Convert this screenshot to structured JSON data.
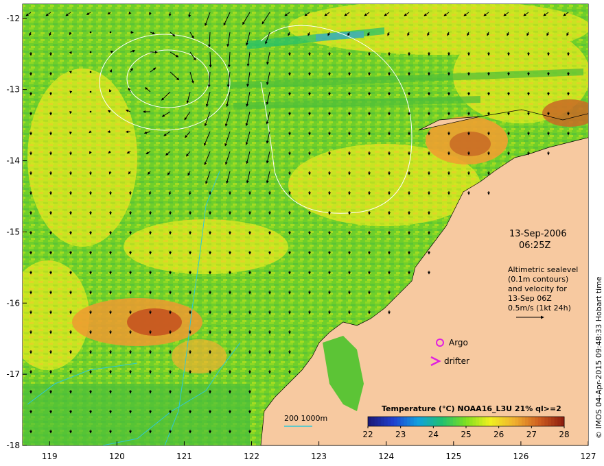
{
  "map": {
    "lon_range": [
      118.6,
      127.0
    ],
    "lat_range": [
      -18.0,
      -11.8
    ],
    "x_ticks": [
      "119",
      "120",
      "121",
      "122",
      "123",
      "124",
      "125",
      "126",
      "127"
    ],
    "y_ticks": [
      "-12",
      "-13",
      "-14",
      "-15",
      "-16",
      "-17",
      "-18"
    ],
    "colors": {
      "land": "#f7c9a0",
      "ocean_base": "#7fd22a",
      "arrow": "#000000",
      "contour": "#ffffff",
      "isobath": "#2ec8d8",
      "argo": "#e020e0",
      "drifter": "#e020e0"
    }
  },
  "annotations": {
    "date": "13-Sep-2006",
    "time": "06:25Z",
    "altimetry_lines": [
      "Altimetric sealevel",
      "(0.1m contours)",
      "and velocity for",
      "13-Sep 06Z",
      "0.5m/s (1kt 24h)"
    ],
    "argo_label": "Argo",
    "drifter_label": "drifter",
    "depth_label": "200  1000m"
  },
  "colorbar": {
    "title": "Temperature (°C) NOAA16_L3U 21% ql>=2",
    "ticks": [
      "22",
      "23",
      "24",
      "25",
      "26",
      "27",
      "28"
    ],
    "colors": [
      "#1a1a7a",
      "#2040d0",
      "#10a0e0",
      "#20c070",
      "#80e020",
      "#f0f020",
      "#f0b030",
      "#d06020",
      "#902010"
    ]
  },
  "credit": "© IMOS 04-Apr-2015 09:48:33 Hobart time"
}
